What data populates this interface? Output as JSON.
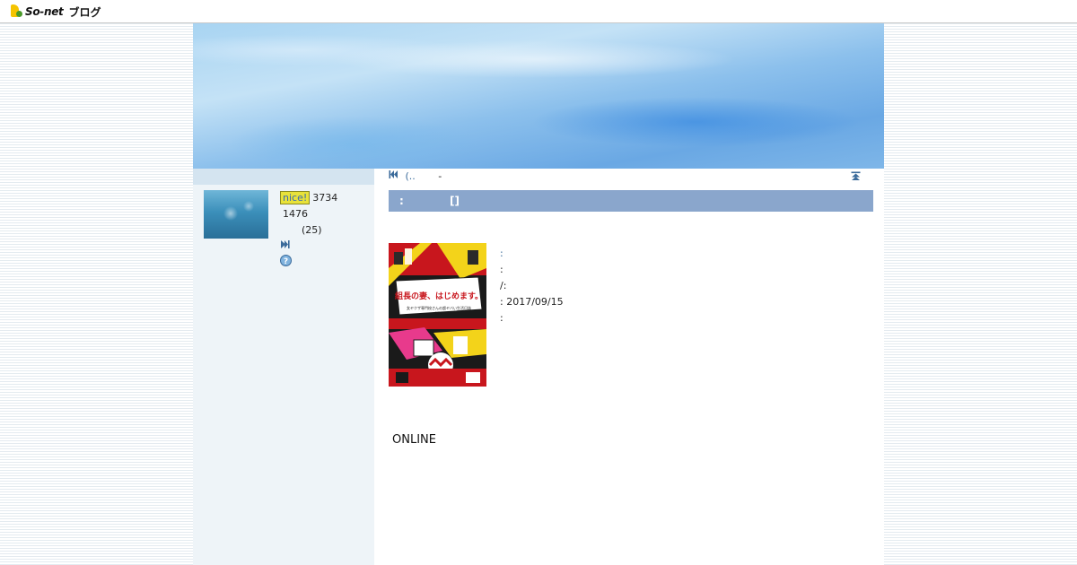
{
  "topbar": {
    "logo_text": "So-net",
    "logo_sub": "ブログ"
  },
  "sidebar": {
    "nice_badge": "nice!",
    "nice_count": "3734",
    "count2": "1476",
    "count3": "(25)"
  },
  "main": {
    "nav_prev": "(..",
    "nav_sep": "-",
    "title_bar_left": ":",
    "title_bar_right": "[]",
    "book": {
      "title": "組長の妻、はじめます。",
      "subtitle": "女ヤクザ専門校さんの超ヤバい生活日誌",
      "publisher_mark": "新潮社"
    },
    "info": {
      "row1": ":",
      "row2": ":",
      "row3": "/:",
      "row4": ": 2017/09/15",
      "row5": ":"
    },
    "online": "ONLINE"
  },
  "colors": {
    "title_bar": "#8aa6cc",
    "link": "#3a6a9a",
    "nice_badge_bg": "#e8e23a"
  }
}
